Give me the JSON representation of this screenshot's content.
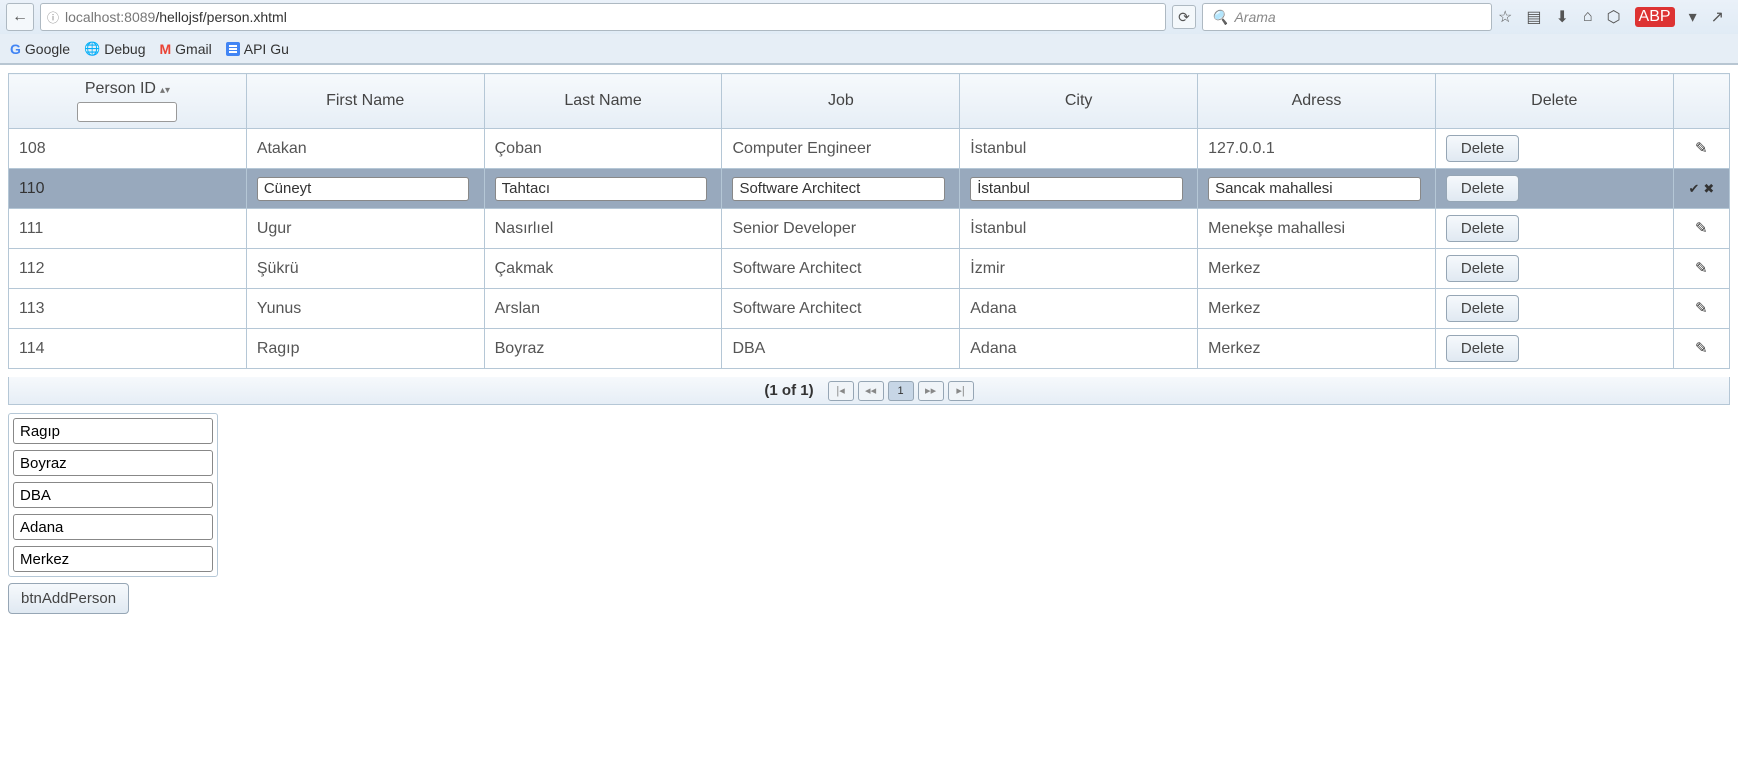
{
  "browser": {
    "url_host": "localhost",
    "url_port": ":8089",
    "url_path": "/hellojsf/person.xhtml",
    "search_placeholder": "Arama"
  },
  "bookmarks": {
    "google": "Google",
    "debug": "Debug",
    "gmail": "Gmail",
    "api_gu": "API Gu"
  },
  "table": {
    "headers": {
      "id": "Person ID",
      "first": "First Name",
      "last": "Last Name",
      "job": "Job",
      "city": "City",
      "address": "Adress",
      "delete": "Delete"
    },
    "filter_id_value": "",
    "delete_label": "Delete",
    "rows": [
      {
        "id": "108",
        "first": "Atakan",
        "last": "Çoban",
        "job": "Computer Engineer",
        "city": "İstanbul",
        "address": "127.0.0.1",
        "editing": false
      },
      {
        "id": "110",
        "first": "Cüneyt",
        "last": "Tahtacı",
        "job": "Software Architect",
        "city": "İstanbul",
        "address": "Sancak mahallesi",
        "editing": true
      },
      {
        "id": "111",
        "first": "Ugur",
        "last": "Nasırlıel",
        "job": "Senior Developer",
        "city": "İstanbul",
        "address": "Menekşe mahallesi",
        "editing": false
      },
      {
        "id": "112",
        "first": "Şükrü",
        "last": "Çakmak",
        "job": "Software Architect",
        "city": "İzmir",
        "address": "Merkez",
        "editing": false
      },
      {
        "id": "113",
        "first": "Yunus",
        "last": "Arslan",
        "job": "Software Architect",
        "city": "Adana",
        "address": "Merkez",
        "editing": false
      },
      {
        "id": "114",
        "first": "Ragıp",
        "last": "Boyraz",
        "job": "DBA",
        "city": "Adana",
        "address": "Merkez",
        "editing": false
      }
    ]
  },
  "paginator": {
    "info": "(1 of 1)",
    "current": "1"
  },
  "form": {
    "first": "Ragıp",
    "last": "Boyraz",
    "job": "DBA",
    "city": "Adana",
    "address": "Merkez",
    "add_label": "btnAddPerson"
  }
}
